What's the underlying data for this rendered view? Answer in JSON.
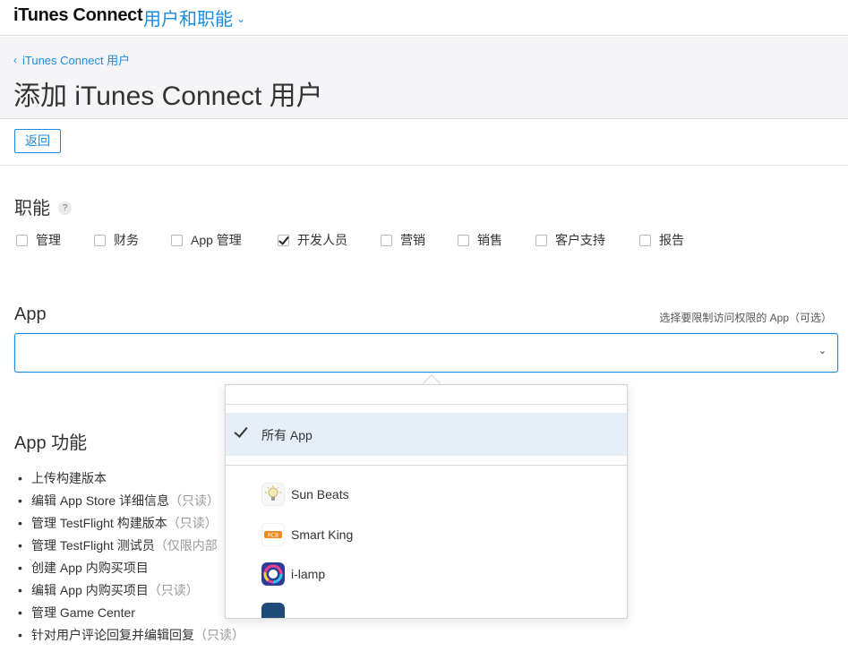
{
  "topbar": {
    "brand": "iTunes Connect",
    "section": "用户和职能"
  },
  "header": {
    "breadcrumb": "iTunes Connect 用户",
    "title": "添加 iTunes Connect 用户"
  },
  "actions": {
    "back": "返回"
  },
  "roles": {
    "title": "职能",
    "help": "?",
    "items": [
      {
        "label": "管理",
        "checked": false
      },
      {
        "label": "财务",
        "checked": false
      },
      {
        "label": "App 管理",
        "checked": false
      },
      {
        "label": "开发人员",
        "checked": true
      },
      {
        "label": "营销",
        "checked": false
      },
      {
        "label": "销售",
        "checked": false
      },
      {
        "label": "客户支持",
        "checked": false
      },
      {
        "label": "报告",
        "checked": false
      }
    ]
  },
  "app": {
    "label": "App",
    "hint": "选择要限制访问权限的 App（可选）",
    "value": ""
  },
  "features": {
    "title": "App 功能",
    "items": [
      {
        "text": "上传构建版本",
        "note": ""
      },
      {
        "text": "编辑 App Store 详细信息",
        "note": "（只读）"
      },
      {
        "text": "管理 TestFlight 构建版本",
        "note": "（只读）"
      },
      {
        "text": "管理 TestFlight 测试员",
        "note": "（仅限内部"
      },
      {
        "text": "创建 App 内购买项目",
        "note": ""
      },
      {
        "text": "编辑 App 内购买项目",
        "note": "（只读）"
      },
      {
        "text": "管理 Game Center",
        "note": ""
      },
      {
        "text": "针对用户评论回复并编辑回复",
        "note": "（只读）"
      }
    ]
  },
  "dropdown": {
    "all_label": "所有 App",
    "apps": [
      {
        "name": "Sun Beats",
        "icon": "sun-beats-icon"
      },
      {
        "name": "Smart King",
        "icon": "smart-king-icon"
      },
      {
        "name": "i-lamp",
        "icon": "i-lamp-icon"
      },
      {
        "name": "",
        "icon": "partial-app-icon"
      }
    ]
  },
  "colors": {
    "accent": "#1b8be0",
    "selected_row": "#e6eef8"
  }
}
